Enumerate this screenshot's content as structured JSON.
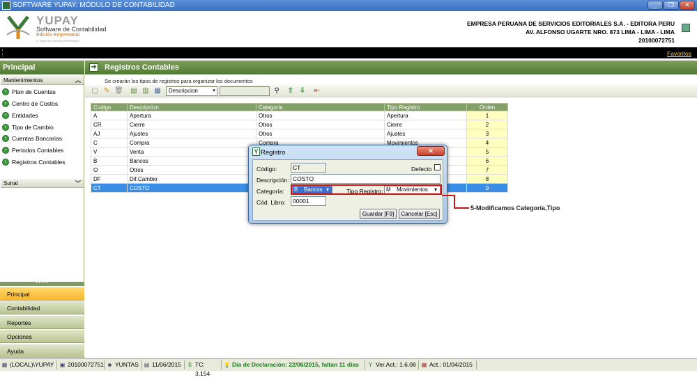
{
  "window": {
    "title": "SOFTWARE YUPAY: MÓDULO DE CONTABILIDAD",
    "min": "_",
    "max": "❐",
    "close": "✕"
  },
  "brand": {
    "name": "YUPAY",
    "subtitle": "Software de Contabilidad",
    "edition": "Edición Empresarial",
    "rights": "© Todos los Derechos Reservados"
  },
  "company": {
    "name": "EMPRESA PERUANA DE SERVICIOS EDITORIALES S.A. - EDITORA PERU",
    "address": "AV. ALFONSO UGARTE NRO. 873 LIMA - LIMA - LIMA",
    "ruc": "20100072751"
  },
  "favorites": "Favoritos",
  "sidebar": {
    "title": "Principal",
    "group1": "Mantenimientos",
    "items": [
      "Plan de Cuentas",
      "Centro de Costos",
      "Entidades",
      "Tipo de Cambio",
      "Cuentas Bancarias",
      "Periodos Contables",
      "Registros Contables"
    ],
    "group2": "Sunat",
    "nav": [
      "Principal",
      "Contabilidad",
      "Reportes",
      "Opciones",
      "Ayuda"
    ]
  },
  "main": {
    "title": "Registros Contables",
    "subtitle": "Se crearán los tipos de registros para organizar los documentos",
    "filter_field": "Descripcion"
  },
  "grid": {
    "headers": [
      "Codigo",
      "Descripcion",
      "Categoria",
      "Tipo Registro",
      "Orden"
    ],
    "rows": [
      [
        "A",
        "Apertura",
        "Otros",
        "Apertura",
        "1"
      ],
      [
        "CR",
        "Cierre",
        "Otros",
        "Cierre",
        "2"
      ],
      [
        "AJ",
        "Ajustes",
        "Otros",
        "Ajustes",
        "3"
      ],
      [
        "C",
        "Compra",
        "Compra",
        "Movimientos",
        "4"
      ],
      [
        "V",
        "Venta",
        "",
        "",
        "5"
      ],
      [
        "B",
        "Bancos",
        "",
        "",
        "6"
      ],
      [
        "O",
        "Otros",
        "",
        "",
        "7"
      ],
      [
        "DF",
        "Dif.Cambio",
        "",
        "",
        "8"
      ],
      [
        "CT",
        "COSTO",
        "",
        "",
        "9"
      ]
    ]
  },
  "dialog": {
    "title": "Registro",
    "codigo_label": "Código:",
    "codigo_value": "CT",
    "defecto_label": "Defecto",
    "descripcion_label": "Descripción:",
    "descripcion_value": "COSTO",
    "categoria_label": "Categoría:",
    "categoria_code": "B",
    "categoria_value": "Bancos",
    "tipo_label": "Tipo Registro:",
    "tipo_code": "M",
    "tipo_value": "Movimientos",
    "libro_label": "Cód. Libro:",
    "libro_value": "00001",
    "save": "Guardar [F9]",
    "cancel": "Cancelar [Esc]"
  },
  "annotation": "5-Modificamos Categoría,Tipo",
  "status": {
    "server": "(LOCAL)\\YUPAY",
    "ruc": "20100072751",
    "user": "YUNTAS",
    "date": "11/06/2015",
    "tc": "TC: 3.154",
    "declaracion": "Día de Declaración: 22/06/2015, faltan 11 días",
    "version": "Ver.Act.: 1.6.08",
    "act": "Act.: 01/04/2015"
  },
  "colors": {
    "accent_green": "#4f7a34",
    "selection": "#3a8ee6",
    "highlight_red": "#cc1111",
    "declaracion_text": "#1a7a1a"
  }
}
